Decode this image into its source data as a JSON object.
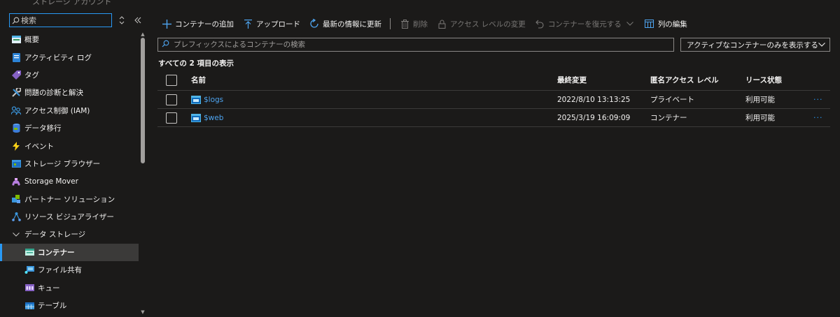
{
  "sidebar": {
    "top_title": "ストレージ アカウント",
    "search_placeholder": "検索",
    "items": [
      {
        "label": "概要",
        "icon": "overview-icon"
      },
      {
        "label": "アクティビティ ログ",
        "icon": "activity-log-icon"
      },
      {
        "label": "タグ",
        "icon": "tag-icon"
      },
      {
        "label": "問題の診断と解決",
        "icon": "wrench-icon"
      },
      {
        "label": "アクセス制御 (IAM)",
        "icon": "people-icon"
      },
      {
        "label": "データ移行",
        "icon": "data-migration-icon"
      },
      {
        "label": "イベント",
        "icon": "lightning-icon"
      },
      {
        "label": "ストレージ ブラウザー",
        "icon": "storage-browser-icon"
      },
      {
        "label": "Storage Mover",
        "icon": "storage-mover-icon"
      },
      {
        "label": "パートナー ソリューション",
        "icon": "partner-icon"
      },
      {
        "label": "リソース ビジュアライザー",
        "icon": "resource-visualizer-icon"
      }
    ],
    "group": {
      "label": "データ ストレージ",
      "icon": "chevron-down-icon"
    },
    "sub_items": [
      {
        "label": "コンテナー",
        "icon": "container-icon",
        "active": true
      },
      {
        "label": "ファイル共有",
        "icon": "file-share-icon"
      },
      {
        "label": "キュー",
        "icon": "queue-icon"
      },
      {
        "label": "テーブル",
        "icon": "table-icon"
      }
    ]
  },
  "toolbar": {
    "add_container": "コンテナーの追加",
    "upload": "アップロード",
    "refresh": "最新の情報に更新",
    "delete": "削除",
    "change_access": "アクセス レベルの変更",
    "restore": "コンテナーを復元する",
    "edit_columns": "列の編集"
  },
  "search": {
    "placeholder": "プレフィックスによるコンテナーの検索"
  },
  "filter": {
    "label": "アクティブなコンテナーのみを表示する"
  },
  "count_label": "すべての 2 項目の表示",
  "table": {
    "headers": {
      "name": "名前",
      "last_modified": "最終変更",
      "access_level": "匿名アクセス レベル",
      "lease_state": "リース状態"
    },
    "rows": [
      {
        "name": "$logs",
        "last_modified": "2022/8/10 13:13:25",
        "access_level": "プライベート",
        "lease_state": "利用可能"
      },
      {
        "name": "$web",
        "last_modified": "2025/3/19 16:09:09",
        "access_level": "コンテナー",
        "lease_state": "利用可能"
      }
    ],
    "more": "···"
  },
  "colors": {
    "accent": "#2899f5",
    "link": "#4ea5f1",
    "background": "#1b1a19"
  }
}
